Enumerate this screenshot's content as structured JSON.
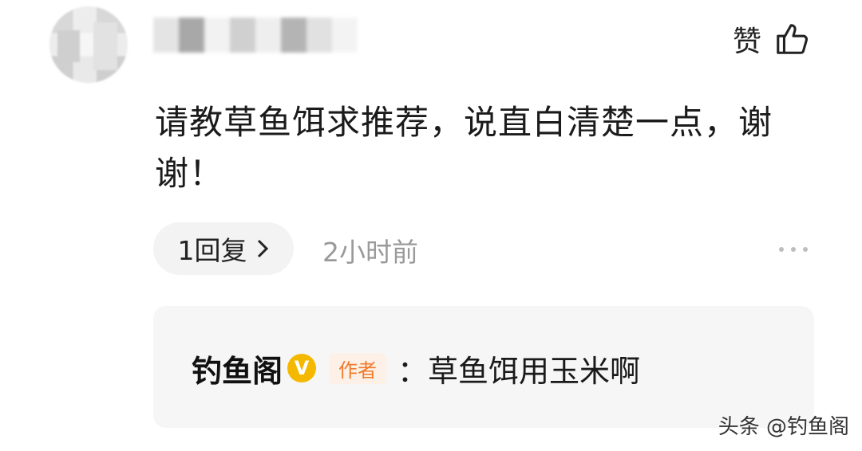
{
  "header": {
    "like_label": "赞"
  },
  "comment": {
    "text": "请教草鱼饵求推荐，说直白清楚一点，谢谢！",
    "reply_count_label": "1回复",
    "timestamp": "2小时前"
  },
  "reply": {
    "author": "钓鱼阁",
    "verified_glyph": "V",
    "author_badge": "作者",
    "separator": "：",
    "text": "草鱼饵用玉米啊"
  },
  "watermark": "头条 @钓鱼阁",
  "colors": {
    "verified": "#f5b800",
    "author_badge_text": "#f07a2a",
    "reply_background": "#f6f6f6",
    "muted_text": "#9a9a9a"
  }
}
